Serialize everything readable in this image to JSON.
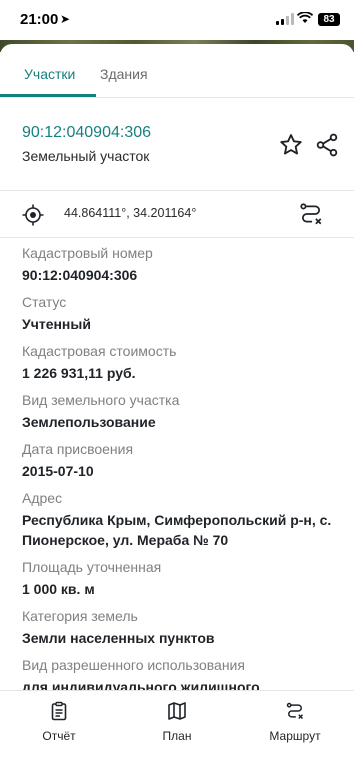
{
  "status_bar": {
    "time": "21:00",
    "battery": "83"
  },
  "tabs": [
    {
      "label": "Участки",
      "active": true
    },
    {
      "label": "Здания",
      "active": false
    }
  ],
  "header": {
    "cadastral_number": "90:12:040904:306",
    "subtitle": "Земельный участок"
  },
  "coordinates": "44.864111°, 34.201164°",
  "fields": [
    {
      "label": "Кадастровый номер",
      "value": "90:12:040904:306"
    },
    {
      "label": "Статус",
      "value": "Учтенный"
    },
    {
      "label": "Кадастровая стоимость",
      "value": "1 226 931,11 руб."
    },
    {
      "label": "Вид земельного участка",
      "value": "Землепользование"
    },
    {
      "label": "Дата присвоения",
      "value": "2015-07-10"
    },
    {
      "label": "Адрес",
      "value": "Республика Крым, Симферопольский р-н, с. Пионерское, ул. Мераба № 70"
    },
    {
      "label": "Площадь уточненная",
      "value": "1 000 кв. м"
    },
    {
      "label": "Категория земель",
      "value": "Земли населенных пунктов"
    },
    {
      "label": "Вид разрешенного использования",
      "value": "для индивидуального жилищного строительства"
    }
  ],
  "bottom_nav": {
    "report": "Отчёт",
    "plan": "План",
    "route": "Маршрут"
  },
  "colors": {
    "accent": "#17807f",
    "label_gray": "#808080"
  },
  "icons": [
    "location-arrow-icon",
    "signal-icon",
    "wifi-icon",
    "battery-icon",
    "star-icon",
    "share-icon",
    "target-icon",
    "route-icon",
    "report-icon",
    "map-icon"
  ]
}
